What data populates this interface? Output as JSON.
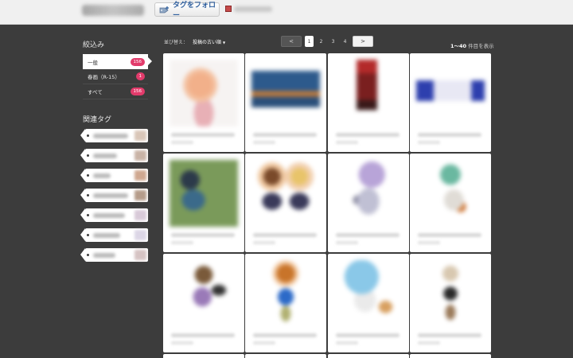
{
  "header": {
    "follow_label": "タグをフォロー",
    "follow_icon": "tag-plus-icon"
  },
  "sidebar": {
    "filter_heading": "絞込み",
    "filters": [
      {
        "label": "一般",
        "count": "156",
        "active": true
      },
      {
        "label": "春画（R-15）",
        "count": "1",
        "active": false
      },
      {
        "label": "すべて",
        "count": "156",
        "active": false
      }
    ],
    "related_heading": "関連タグ",
    "related_tags_count": 7
  },
  "toolbar": {
    "sort_label": "並び替え：",
    "sort_value": "投稿の古い順",
    "sort_arrow": "▼",
    "prev_label": "<",
    "next_label": ">",
    "pages": [
      "1",
      "2",
      "3",
      "4"
    ],
    "current_page": "1",
    "range_strong": "1〜40",
    "range_rest": " 件目を表示"
  },
  "colors": {
    "background": "#3c3c3c",
    "badge": "#e23b6b",
    "header": "#f0f0f0",
    "follow_text": "#2f5f9e"
  }
}
